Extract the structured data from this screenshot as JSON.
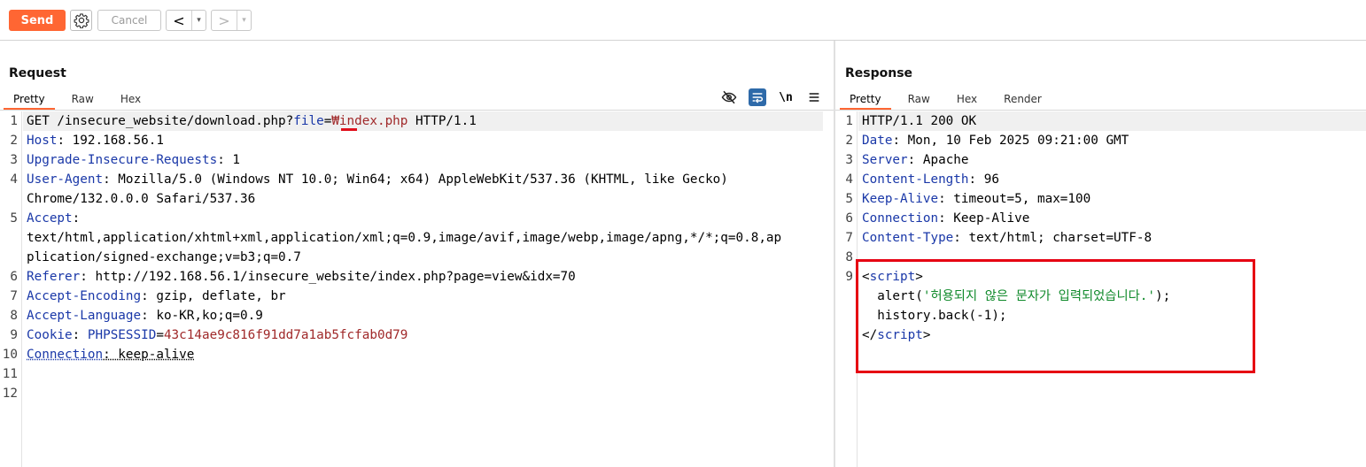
{
  "toolbar": {
    "send_label": "Send",
    "cancel_label": "Cancel",
    "back_glyph": "<",
    "forward_glyph": ">",
    "dropdown_glyph": "▾"
  },
  "request": {
    "title": "Request",
    "tabs": [
      "Pretty",
      "Raw",
      "Hex"
    ],
    "newline_label": "\\n",
    "lines": {
      "l1_method": "GET /insecure_website/download.php?",
      "l1_param": "file",
      "l1_eq": "=",
      "l1_value": "₩index.php",
      "l1_proto": " HTTP/1.1",
      "l2_key": "Host",
      "l2_val": ": 192.168.56.1",
      "l3_key": "Upgrade-Insecure-Requests",
      "l3_val": ": 1",
      "l4_key": "User-Agent",
      "l4_val": ": Mozilla/5.0 (Windows NT 10.0; Win64; x64) AppleWebKit/537.36 (KHTML, like Gecko)",
      "l4_cont": "Chrome/132.0.0.0 Safari/537.36",
      "l5_key": "Accept",
      "l5_sep": ":",
      "l5_val_a": "text/html,application/xhtml+xml,application/xml;q=0.9,image/avif,image/webp,image/apng,*/*;q=0.8,ap",
      "l5_val_b": "plication/signed-exchange;v=b3;q=0.7",
      "l6_key": "Referer",
      "l6_val": ": http://192.168.56.1/insecure_website/index.php?page=view&idx=70",
      "l7_key": "Accept-Encoding",
      "l7_val": ": gzip, deflate, br",
      "l8_key": "Accept-Language",
      "l8_val": ": ko-KR,ko;q=0.9",
      "l9_key": "Cookie",
      "l9_sep": ": ",
      "l9_cookie_name": "PHPSESSID",
      "l9_eq": "=",
      "l9_cookie_val": "43c14ae9c816f91dd7a1ab5fcfab0d79",
      "l10_key": "Connection",
      "l10_val": ": keep-alive"
    },
    "line_numbers": [
      "1",
      "2",
      "3",
      "4",
      "5",
      "6",
      "7",
      "8",
      "9",
      "10",
      "11",
      "12"
    ]
  },
  "response": {
    "title": "Response",
    "tabs": [
      "Pretty",
      "Raw",
      "Hex",
      "Render"
    ],
    "lines": {
      "l1": "HTTP/1.1 200 OK",
      "l2_key": "Date",
      "l2_val": ": Mon, 10 Feb 2025 09:21:00 GMT",
      "l3_key": "Server",
      "l3_val": ": Apache",
      "l4_key": "Content-Length",
      "l4_val": ": 96",
      "l5_key": "Keep-Alive",
      "l5_val": ": timeout=5, max=100",
      "l6_key": "Connection",
      "l6_val": ": Keep-Alive",
      "l7_key": "Content-Type",
      "l7_val": ": text/html; charset=UTF-8",
      "tag_open_lt": "<",
      "tag_name": "script",
      "tag_open_gt": ">",
      "alert_pre": "  alert(",
      "alert_str": "'허용되지 않은 문자가 입력되었습니다.'",
      "alert_post": ");",
      "history": "  history.back(-1);",
      "tag_close_lt": "</"
    },
    "line_numbers": [
      "1",
      "2",
      "3",
      "4",
      "5",
      "6",
      "7",
      "8",
      "9"
    ]
  },
  "colors": {
    "accent": "#ff6633",
    "header_key": "#1a38a8",
    "param_value": "#a0292a",
    "string": "#108a2b",
    "annotation_red": "#e60012"
  }
}
